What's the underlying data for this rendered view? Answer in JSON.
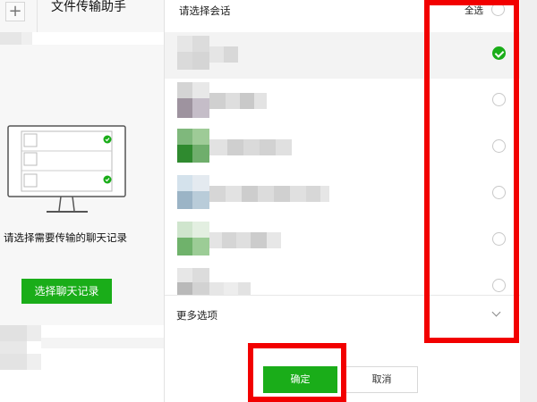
{
  "left_panel": {
    "add_icon": "plus-icon",
    "chat_title": "文件传输助手",
    "tip_text": "请选择需要传输的聊天记录",
    "select_button": "选择聊天记录",
    "check_icon": "check-icon"
  },
  "dialog": {
    "title": "请选择会话",
    "select_all": "全选",
    "rows": [
      {
        "checked": true
      },
      {
        "checked": false
      },
      {
        "checked": false
      },
      {
        "checked": false
      },
      {
        "checked": false
      },
      {
        "checked": false
      }
    ],
    "more_options": "更多选项",
    "ok_button": "确定",
    "cancel_button": "取消"
  },
  "colors": {
    "accent_green": "#1aad19",
    "highlight_red": "#f20000"
  }
}
